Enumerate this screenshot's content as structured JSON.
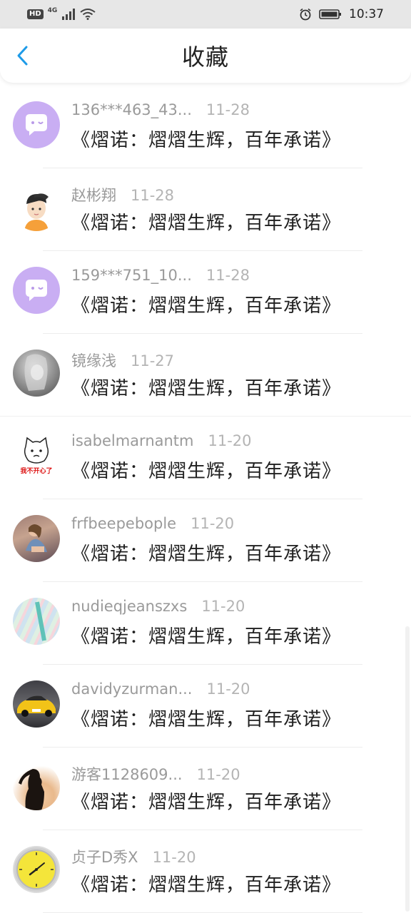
{
  "status_bar": {
    "hd": "HD",
    "network": "4G",
    "time": "10:37"
  },
  "header": {
    "title": "收藏",
    "back_icon": "chevron-left-icon"
  },
  "items": [
    {
      "name": "136***463_43...",
      "date": "11-28",
      "title": "《熠诺：熠熠生辉，百年承诺》",
      "avatar": "chat-bubble-purple"
    },
    {
      "name": "赵彬翔",
      "date": "11-28",
      "title": "《熠诺：熠熠生辉，百年承诺》",
      "avatar": "cartoon-boy"
    },
    {
      "name": "159***751_10...",
      "date": "11-28",
      "title": "《熠诺：熠熠生辉，百年承诺》",
      "avatar": "chat-bubble-purple"
    },
    {
      "name": "镜缘浅",
      "date": "11-27",
      "title": "《熠诺：熠熠生辉，百年承诺》",
      "avatar": "gray-portrait"
    },
    {
      "name": "isabelmarnantm",
      "date": "11-20",
      "title": "《熠诺：熠熠生辉，百年承诺》",
      "avatar": "sad-cat-sticker",
      "avatar_text": "我不开心了"
    },
    {
      "name": "frfbeepebople",
      "date": "11-20",
      "title": "《熠诺：熠熠生辉，百年承诺》",
      "avatar": "woman-photo"
    },
    {
      "name": "nudieqjeanszxs",
      "date": "11-20",
      "title": "《熠诺：熠熠生辉，百年承诺》",
      "avatar": "striped-photo"
    },
    {
      "name": "davidyzurman...",
      "date": "11-20",
      "title": "《熠诺：熠熠生辉，百年承诺》",
      "avatar": "yellow-car"
    },
    {
      "name": "游客1128609...",
      "date": "11-20",
      "title": "《熠诺：熠熠生辉，百年承诺》",
      "avatar": "silhouette-photo"
    },
    {
      "name": "贞子D秀X",
      "date": "11-20",
      "title": "《熠诺：熠熠生辉，百年承诺》",
      "avatar": "yellow-clock"
    }
  ],
  "colors": {
    "accent": "#1e9be8",
    "bubble_purple": "#c9aef3"
  }
}
